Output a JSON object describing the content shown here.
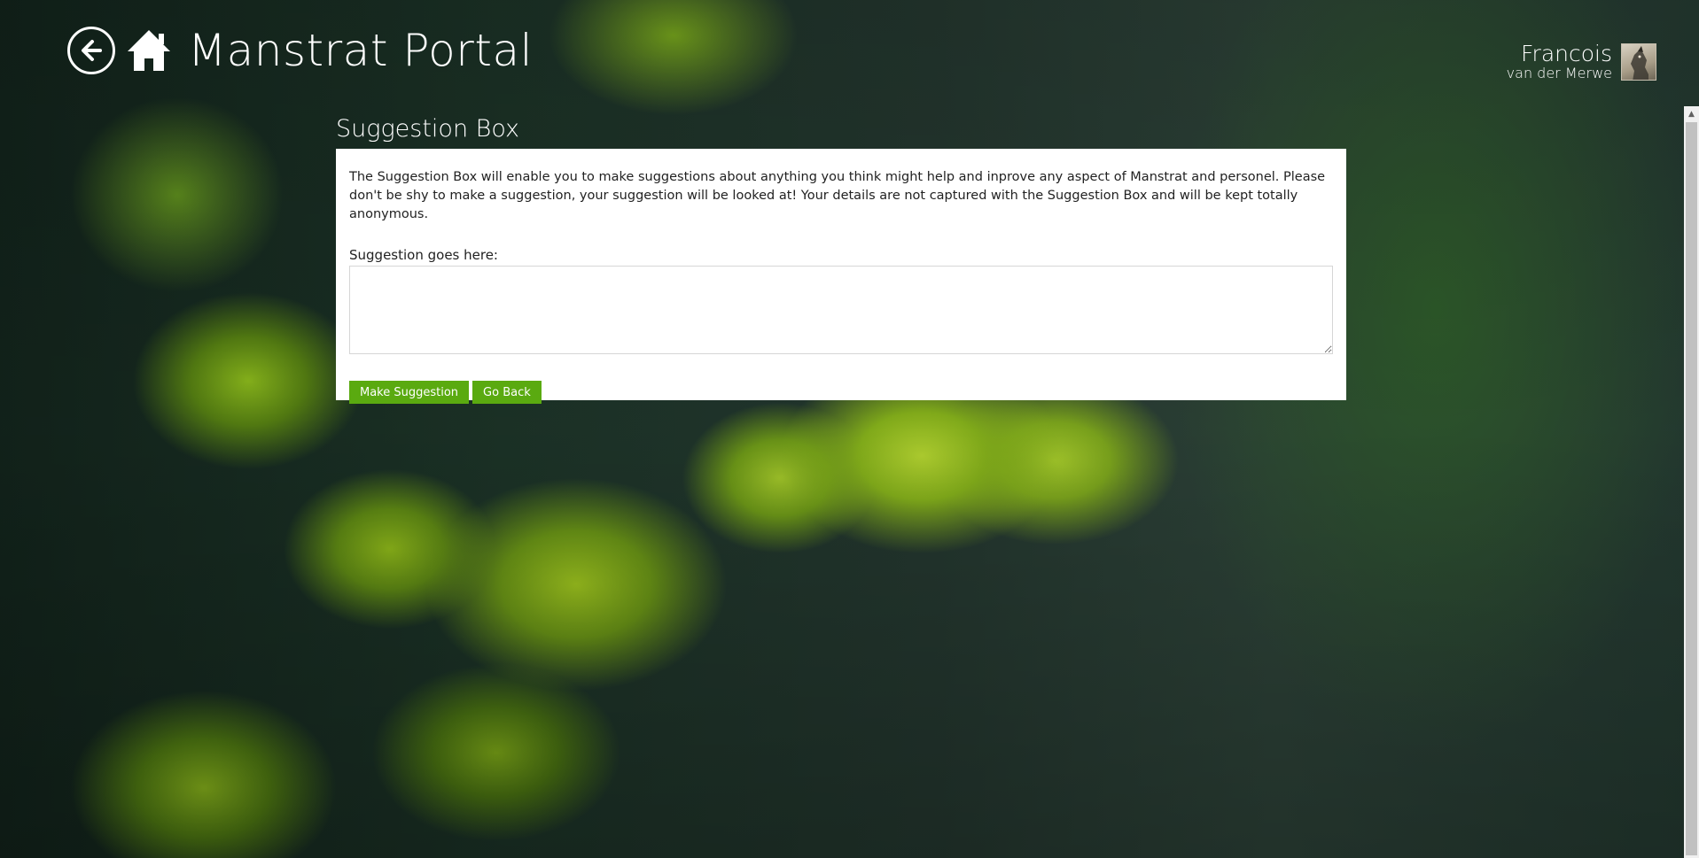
{
  "header": {
    "back_icon": "arrow-left-circle-icon",
    "home_icon": "home-icon",
    "app_title": "Manstrat Portal"
  },
  "user": {
    "first_name": "Francois",
    "last_name": "van der Merwe",
    "avatar_icon": "user-avatar"
  },
  "page": {
    "section_title": "Suggestion Box",
    "intro_text": "The Suggestion Box will enable you to make suggestions about anything you think might help and inprove any aspect of Manstrat and personel. Please don't be shy to make a suggestion, your suggestion will be looked at! Your details are not captured with the Suggestion Box and will be kept totally anonymous.",
    "field_label": "Suggestion goes here:",
    "suggestion_value": "",
    "buttons": {
      "submit_label": "Make Suggestion",
      "back_label": "Go Back"
    }
  },
  "colors": {
    "button_green": "#5aaa10",
    "panel_bg": "#ffffff",
    "header_text": "#ffffff"
  }
}
